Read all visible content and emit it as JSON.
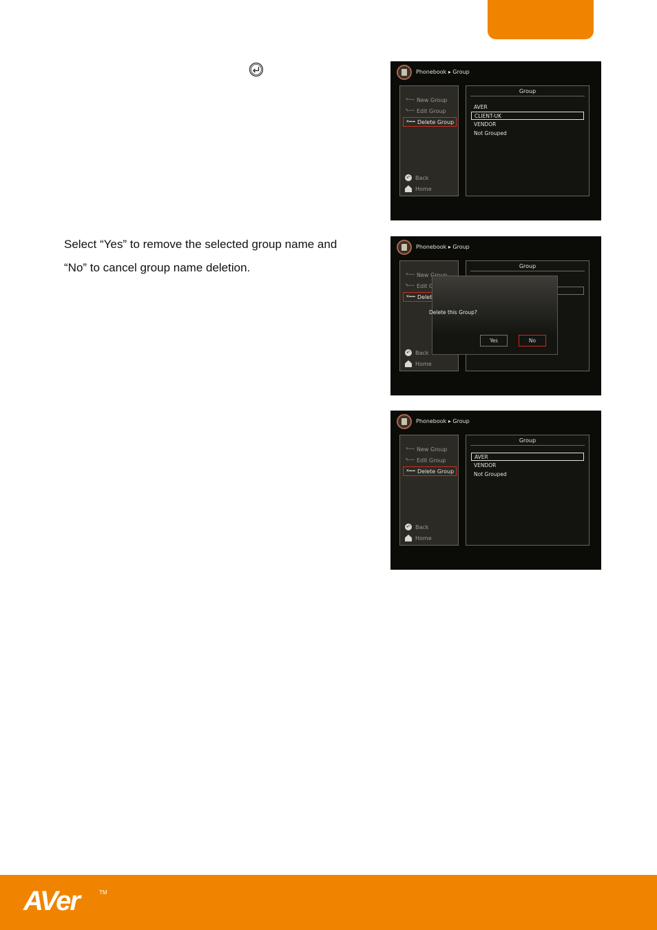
{
  "intro_text": [
    "Select “Yes” to remove the selected group name and",
    "“No” to cancel group name deletion."
  ],
  "screens": {
    "breadcrumb": "Phonebook ▸ Group",
    "menu": {
      "new_group": "New Group",
      "edit_group": "Edit Group",
      "delete_group": "Delete Group",
      "back": "Back",
      "home": "Home"
    },
    "list_title": "Group",
    "shot1_items": [
      "AVER",
      "CLIENT-UK",
      "VENDOR",
      "Not Grouped"
    ],
    "shot3_items": [
      "AVER",
      "VENDOR",
      "Not Grouped"
    ],
    "dialog": {
      "message": "Delete this Group?",
      "yes": "Yes",
      "no": "No"
    }
  },
  "logo": {
    "text": "AVer",
    "tm": "TM"
  },
  "colors": {
    "brand": "#f08400",
    "selection": "#c73020"
  },
  "icons": [
    "enter-key-icon",
    "breadcrumb-contact-icon",
    "new-group-icon",
    "edit-group-icon",
    "delete-group-icon",
    "back-icon",
    "home-icon"
  ]
}
